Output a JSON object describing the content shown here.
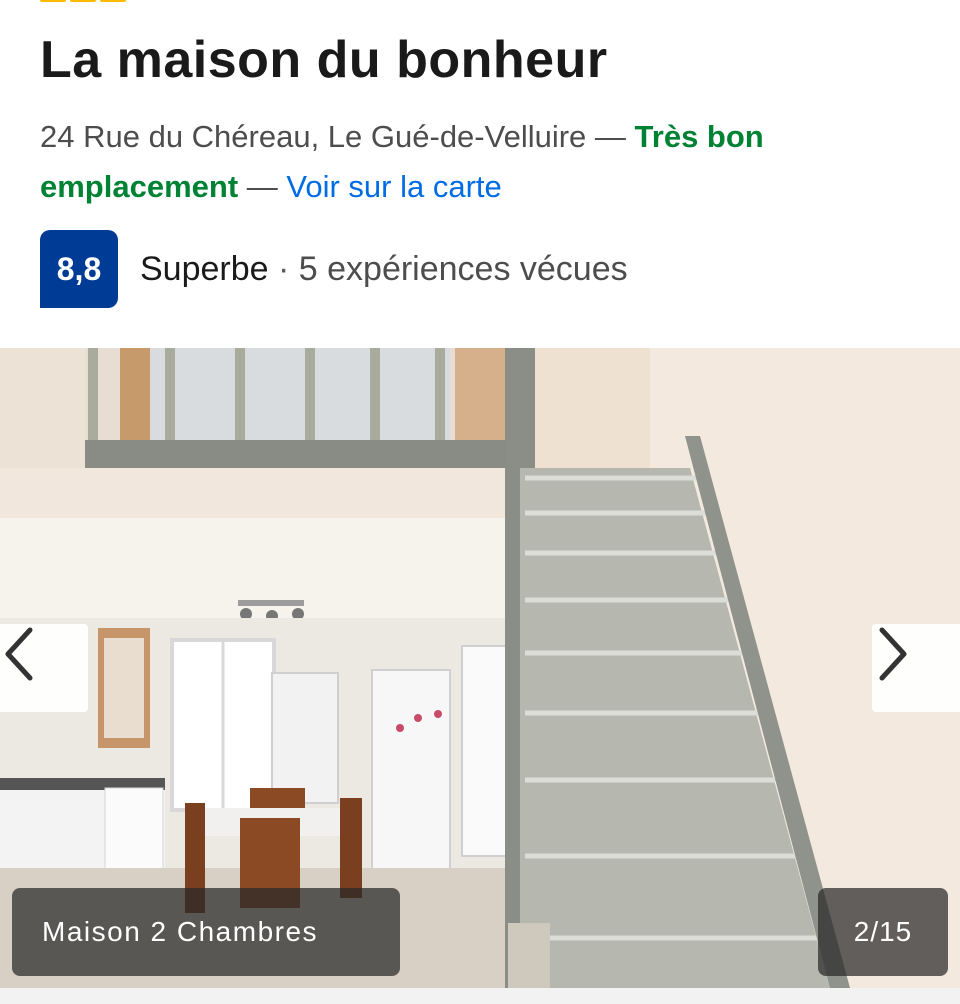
{
  "property": {
    "star_count": 3,
    "title": "La maison du bonheur",
    "address": "24 Rue du Chéreau, Le Gué-de-Velluire",
    "separator_1": " — ",
    "location_badge": "Très bon emplacement",
    "separator_2": " — ",
    "map_link": "Voir sur la carte"
  },
  "rating": {
    "score": "8,8",
    "label": "Superbe",
    "separator": " · ",
    "reviews": "5 expériences vécues"
  },
  "gallery": {
    "caption": "Maison 2 Chambres",
    "counter": "2/15",
    "prev_icon": "chevron-left-icon",
    "next_icon": "chevron-right-icon"
  },
  "colors": {
    "star": "#febb02",
    "green": "#008234",
    "link": "#006ce4",
    "badge": "#003b95"
  }
}
